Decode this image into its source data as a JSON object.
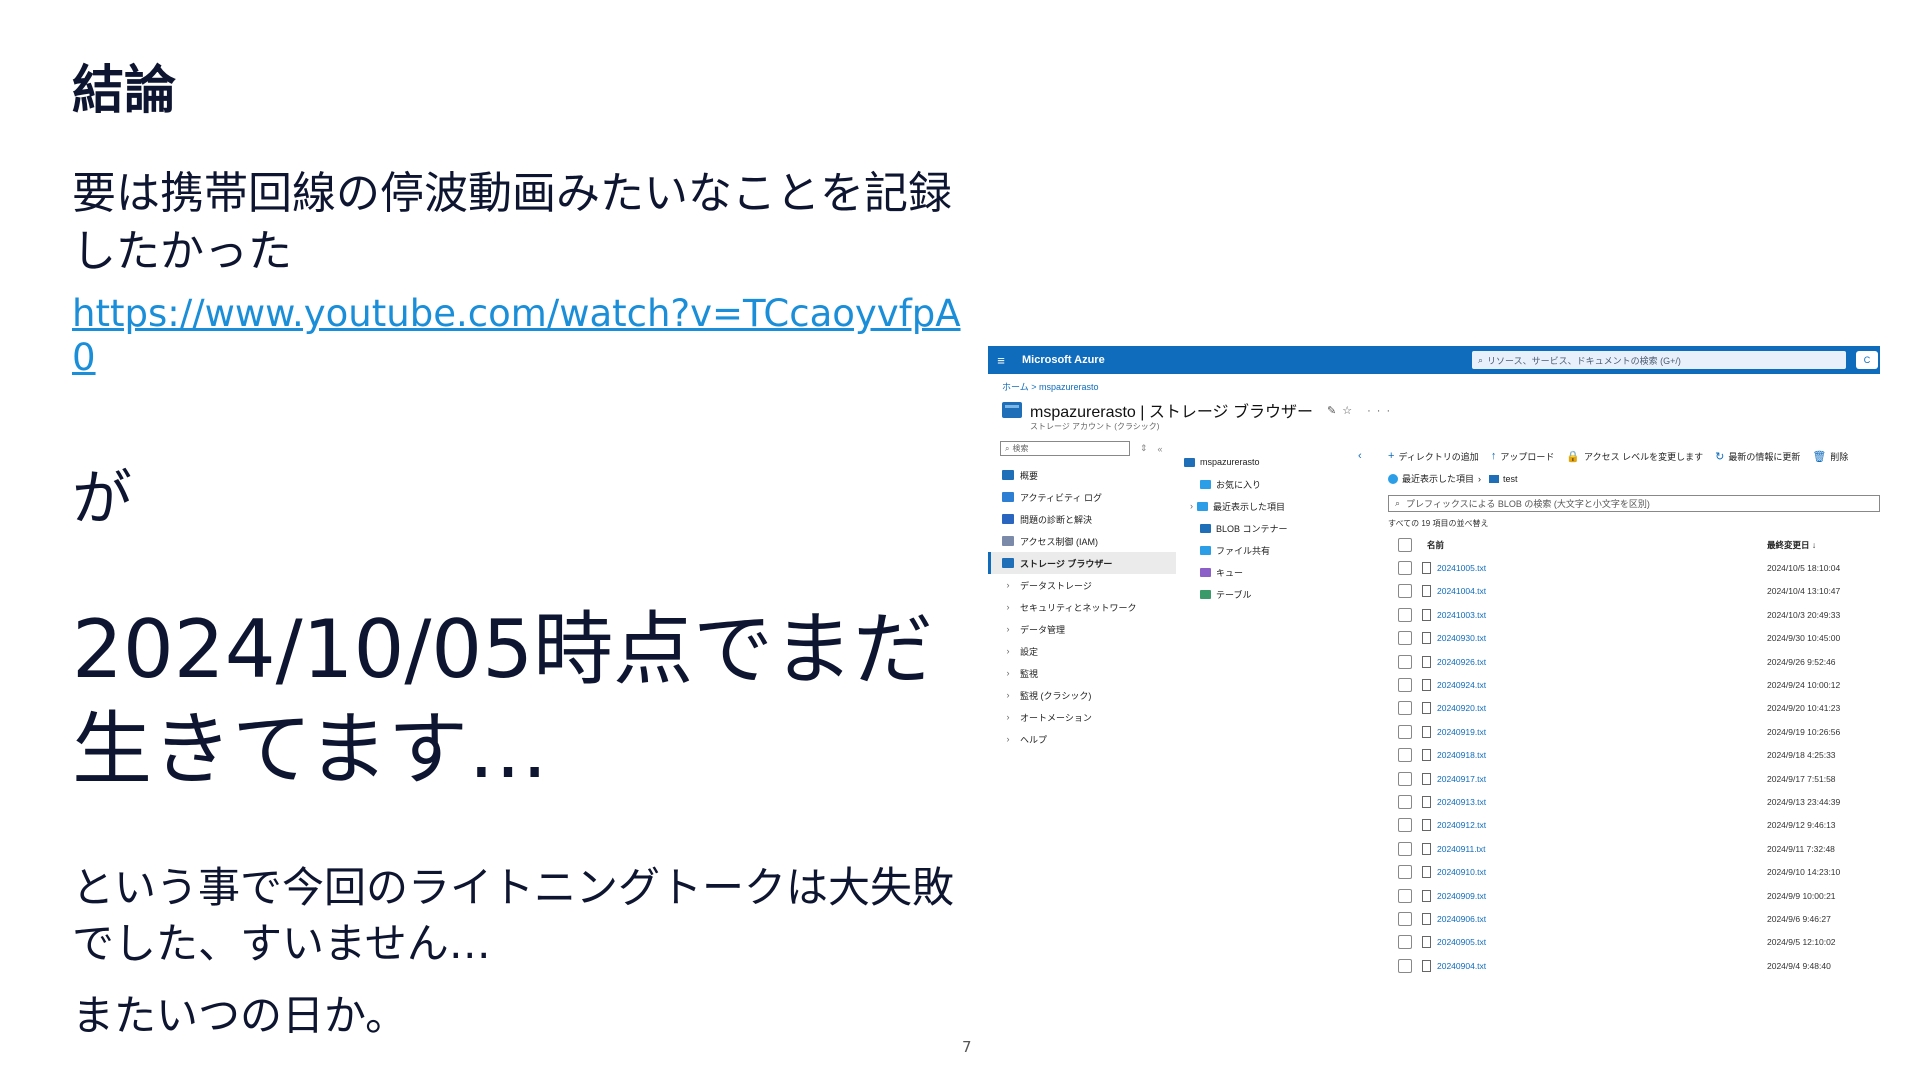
{
  "slide": {
    "title": "結論",
    "intro": "要は携帯回線の停波動画みたいなことを記録したかった",
    "link": "https://www.youtube.com/watch?v=TCcaoyvfpA0",
    "ga": "が",
    "big": "2024/10/05時点でまだ生きてます…",
    "apology": "という事で今回のライトニングトークは大失敗でした、すいません…",
    "closing": "またいつの日か。",
    "page_number": "7"
  },
  "azure": {
    "brand": "Microsoft Azure",
    "search_placeholder": "リソース、サービス、ドキュメントの検索 (G+/)",
    "copilot": "C",
    "breadcrumb": "ホーム  >  mspazurerasto",
    "resource_title": "mspazurerasto | ストレージ ブラウザー",
    "resource_subtitle": "ストレージ アカウント (クラシック)",
    "pin_icons": "☆ ···",
    "nav_search": "検索",
    "nav_items": [
      {
        "label": "概要",
        "kind": "icon",
        "color": "#1e6fb8"
      },
      {
        "label": "アクティビティ ログ",
        "kind": "icon",
        "color": "#2d7fd3"
      },
      {
        "label": "問題の診断と解決",
        "kind": "icon",
        "color": "#2a66c0"
      },
      {
        "label": "アクセス制御 (IAM)",
        "kind": "icon",
        "color": "#7a8aa8"
      },
      {
        "label": "ストレージ ブラウザー",
        "kind": "icon",
        "color": "#1e6fb8",
        "selected": true
      },
      {
        "label": "データストレージ",
        "kind": "chev"
      },
      {
        "label": "セキュリティとネットワーク",
        "kind": "chev"
      },
      {
        "label": "データ管理",
        "kind": "chev"
      },
      {
        "label": "設定",
        "kind": "chev"
      },
      {
        "label": "監視",
        "kind": "chev"
      },
      {
        "label": "監視 (クラシック)",
        "kind": "chev"
      },
      {
        "label": "オートメーション",
        "kind": "chev"
      },
      {
        "label": "ヘルプ",
        "kind": "chev"
      }
    ],
    "tree": [
      {
        "label": "mspazurerasto",
        "color": "#1e6fb8",
        "indent": 0
      },
      {
        "label": "お気に入り",
        "color": "#2c9ee8",
        "indent": 16
      },
      {
        "label": "最近表示した項目",
        "color": "#2c9ee8",
        "indent": 6,
        "chev": "›"
      },
      {
        "label": "BLOB コンテナー",
        "color": "#1e6fb8",
        "indent": 16
      },
      {
        "label": "ファイル共有",
        "color": "#2c9ee8",
        "indent": 16
      },
      {
        "label": "キュー",
        "color": "#8b5fc7",
        "indent": 16
      },
      {
        "label": "テーブル",
        "color": "#3a9a6a",
        "indent": 16
      }
    ],
    "collapse": "‹",
    "cmds": [
      {
        "glyph": "+",
        "label": "ディレクトリの追加"
      },
      {
        "glyph": "↑",
        "label": "アップロード"
      },
      {
        "glyph": "🔒",
        "label": "アクセス レベルを変更します"
      },
      {
        "glyph": "↻",
        "label": "最新の情報に更新"
      },
      {
        "glyph": "🗑",
        "label": "削除"
      }
    ],
    "crumb_recent": "最近表示した項目",
    "crumb_container": "test",
    "prefix_placeholder": "プレフィックスによる BLOB の検索 (大文字と小文字を区別)",
    "count_text": "すべての 19 項目の並べ替え",
    "col_name": "名前",
    "col_modified": "最終変更日 ↓",
    "rows": [
      {
        "name": "20241005.txt",
        "date": "2024/10/5 18:10:04"
      },
      {
        "name": "20241004.txt",
        "date": "2024/10/4 13:10:47"
      },
      {
        "name": "20241003.txt",
        "date": "2024/10/3 20:49:33"
      },
      {
        "name": "20240930.txt",
        "date": "2024/9/30 10:45:00"
      },
      {
        "name": "20240926.txt",
        "date": "2024/9/26 9:52:46"
      },
      {
        "name": "20240924.txt",
        "date": "2024/9/24 10:00:12"
      },
      {
        "name": "20240920.txt",
        "date": "2024/9/20 10:41:23"
      },
      {
        "name": "20240919.txt",
        "date": "2024/9/19 10:26:56"
      },
      {
        "name": "20240918.txt",
        "date": "2024/9/18 4:25:33"
      },
      {
        "name": "20240917.txt",
        "date": "2024/9/17 7:51:58"
      },
      {
        "name": "20240913.txt",
        "date": "2024/9/13 23:44:39"
      },
      {
        "name": "20240912.txt",
        "date": "2024/9/12 9:46:13"
      },
      {
        "name": "20240911.txt",
        "date": "2024/9/11 7:32:48"
      },
      {
        "name": "20240910.txt",
        "date": "2024/9/10 14:23:10"
      },
      {
        "name": "20240909.txt",
        "date": "2024/9/9 10:00:21"
      },
      {
        "name": "20240906.txt",
        "date": "2024/9/6 9:46:27"
      },
      {
        "name": "20240905.txt",
        "date": "2024/9/5 12:10:02"
      },
      {
        "name": "20240904.txt",
        "date": "2024/9/4 9:48:40"
      }
    ]
  }
}
